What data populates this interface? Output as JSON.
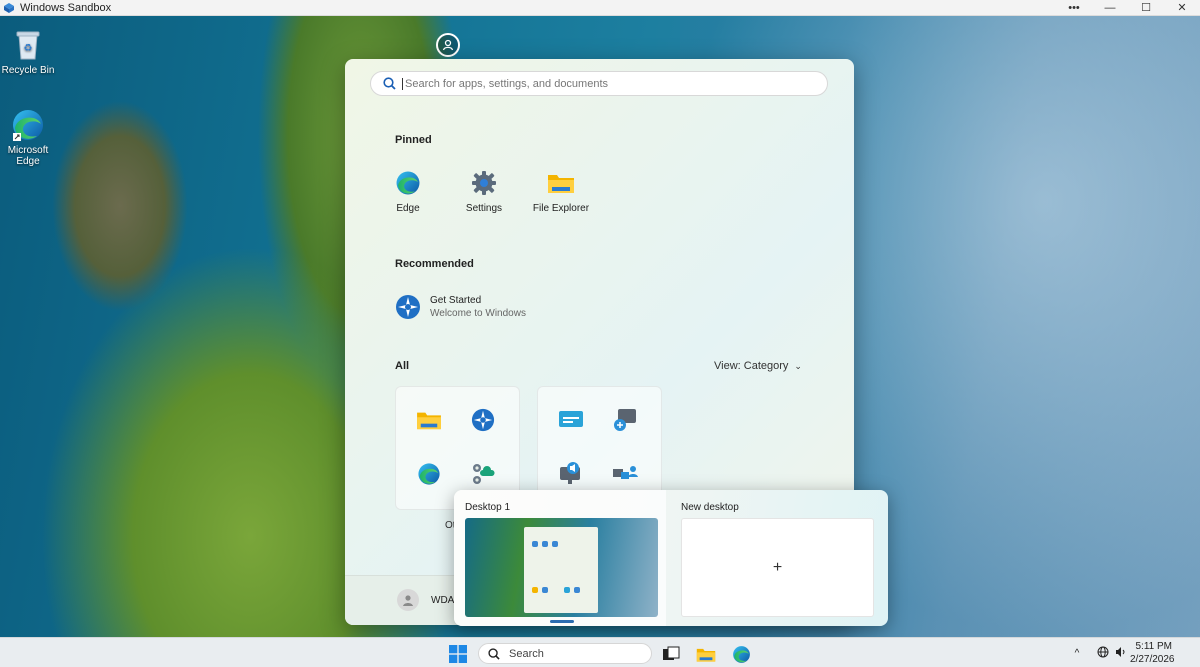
{
  "window": {
    "title": "Windows Sandbox",
    "controls": {
      "more": "•••",
      "minimize": "—",
      "maximize": "☐",
      "close": "✕"
    }
  },
  "desktop": {
    "icons": [
      {
        "label": "Recycle Bin",
        "icon": "recycle-bin-icon"
      },
      {
        "label": "Microsoft Edge",
        "icon": "edge-icon"
      }
    ]
  },
  "start_menu": {
    "search_placeholder": "Search for apps, settings, and documents",
    "pinned_title": "Pinned",
    "pinned": [
      {
        "label": "Edge",
        "icon": "edge-icon"
      },
      {
        "label": "Settings",
        "icon": "settings-gear-icon"
      },
      {
        "label": "File Explorer",
        "icon": "folder-icon"
      }
    ],
    "recommended_title": "Recommended",
    "recommended": [
      {
        "title": "Get Started",
        "subtitle": "Welcome to Windows",
        "icon": "get-started-icon"
      }
    ],
    "all_title": "All",
    "view_label": "View: Category",
    "category_label_partial": "Ot",
    "user_name": "WDAG"
  },
  "task_view": {
    "desktops": [
      {
        "label": "Desktop 1",
        "active": true
      },
      {
        "label": "New desktop",
        "plus": "+"
      }
    ]
  },
  "taskbar": {
    "search_label": "Search",
    "time": "5:11 PM",
    "date": "2/27/2026",
    "tray_chevron": "^"
  },
  "colors": {
    "accent": "#2b6cb0",
    "start_bg": "#eaf4ee",
    "taskbar_bg": "#e9edf0"
  }
}
